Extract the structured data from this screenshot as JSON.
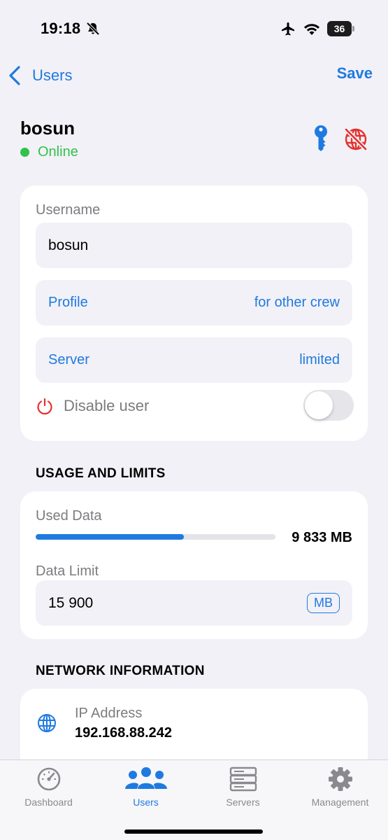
{
  "status_bar": {
    "time": "19:18",
    "battery": "36"
  },
  "nav": {
    "back_label": "Users",
    "save_label": "Save"
  },
  "user": {
    "name": "bosun",
    "status": "Online"
  },
  "details": {
    "username_label": "Username",
    "username_value": "bosun",
    "profile_label": "Profile",
    "profile_value": "for other crew",
    "server_label": "Server",
    "server_value": "limited",
    "disable_label": "Disable user",
    "disable_on": false
  },
  "usage": {
    "header": "USAGE AND LIMITS",
    "used_label": "Used Data",
    "used_value": "9 833 MB",
    "used_fraction": 0.618,
    "limit_label": "Data Limit",
    "limit_value": "15 900",
    "limit_unit": "MB"
  },
  "network": {
    "header": "NETWORK INFORMATION",
    "ip_label": "IP Address",
    "ip_value": "192.168.88.242"
  },
  "tabs": [
    {
      "label": "Dashboard",
      "icon": "gauge-icon",
      "active": false
    },
    {
      "label": "Users",
      "icon": "users-icon",
      "active": true
    },
    {
      "label": "Servers",
      "icon": "servers-icon",
      "active": false
    },
    {
      "label": "Management",
      "icon": "gear-icon",
      "active": false
    }
  ],
  "colors": {
    "accent": "#1f7ae0",
    "online": "#30c24b",
    "danger": "#e5312d",
    "background": "#f2f1f7"
  }
}
